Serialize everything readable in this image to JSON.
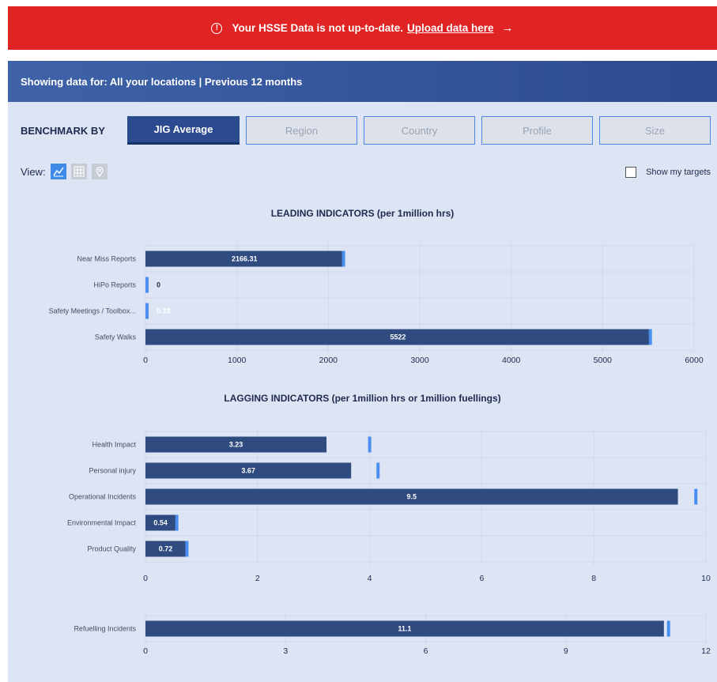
{
  "alert": {
    "message": "Your HSSE Data is not up-to-date.",
    "link_text": "Upload data here",
    "arrow": "→",
    "icon": "warning-circle-icon",
    "color": "#e02323"
  },
  "filter_bar": {
    "text": "Showing data for: All your locations | Previous 12 months"
  },
  "benchmark": {
    "label": "BENCHMARK BY",
    "buttons": [
      {
        "label": "JIG Average",
        "active": true
      },
      {
        "label": "Region",
        "active": false
      },
      {
        "label": "Country",
        "active": false
      },
      {
        "label": "Profile",
        "active": false
      },
      {
        "label": "Size",
        "active": false
      }
    ]
  },
  "view": {
    "label": "View:",
    "icons": [
      "line-chart-icon",
      "grid-table-icon",
      "map-pin-icon"
    ],
    "active": "line-chart-icon"
  },
  "targets": {
    "label": "Show my targets",
    "checked": false
  },
  "colors": {
    "bar": "#2f4b80",
    "benchmark_marker": "#4a8ff0",
    "grid": "#cfd8ea",
    "panel": "#dde5f5"
  },
  "chart_data": [
    {
      "type": "bar",
      "orientation": "horizontal",
      "title": "LEADING INDICATORS (per 1million hrs)",
      "categories": [
        "Near Miss Reports",
        "HiPo Reports",
        "Safety Meetings / Toolbox...",
        "Safety Walks"
      ],
      "values": [
        2166.31,
        0,
        0.33,
        5522
      ],
      "value_labels": [
        "2166.31",
        "0",
        "0.33",
        "5522"
      ],
      "benchmark": [
        2166.31,
        0,
        0.33,
        5522
      ],
      "xlim": [
        0,
        6000
      ],
      "ticks": [
        0,
        1000,
        2000,
        3000,
        4000,
        5000,
        6000
      ],
      "tick_labels": [
        "0",
        "1000",
        "2000",
        "3000",
        "4000",
        "5000",
        "6000"
      ],
      "grid": true
    },
    {
      "type": "bar",
      "orientation": "horizontal",
      "title": "LAGGING INDICATORS (per 1million hrs or 1million fuellings)",
      "categories": [
        "Health Impact",
        "Personal injury",
        "Operational Incidents",
        "Environmental Impact",
        "Product Quality"
      ],
      "values": [
        3.23,
        3.67,
        9.5,
        0.54,
        0.72
      ],
      "value_labels": [
        "3.23",
        "3.67",
        "9.5",
        "0.54",
        "0.72"
      ],
      "benchmark": [
        4,
        4.15,
        9.82,
        0.56,
        0.74
      ],
      "xlim": [
        0,
        10
      ],
      "ticks": [
        0,
        2,
        4,
        6,
        8,
        10
      ],
      "tick_labels": [
        "0",
        "2",
        "4",
        "6",
        "8",
        "10"
      ],
      "grid": true
    },
    {
      "type": "bar",
      "orientation": "horizontal",
      "title": "",
      "categories": [
        "Refuelling Incidents"
      ],
      "values": [
        11.1
      ],
      "value_labels": [
        "11.1"
      ],
      "benchmark": [
        11.2
      ],
      "xlim": [
        0,
        12
      ],
      "ticks": [
        0,
        3,
        6,
        9,
        12
      ],
      "tick_labels": [
        "0",
        "3",
        "6",
        "9",
        "12"
      ],
      "grid": true
    }
  ]
}
